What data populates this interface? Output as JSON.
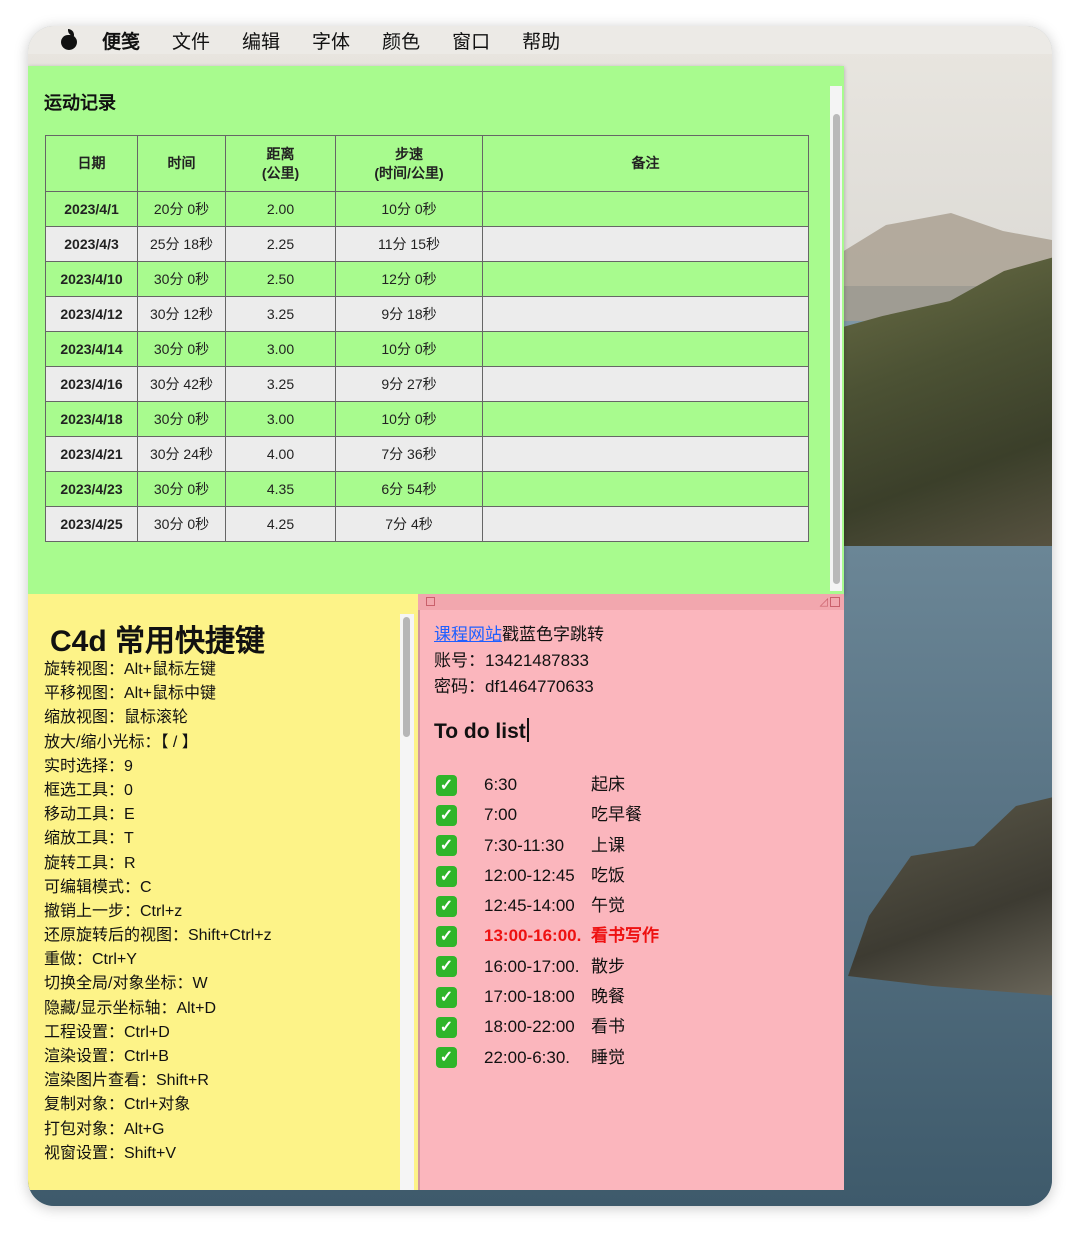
{
  "menubar": {
    "app_name": "便笺",
    "items": [
      "文件",
      "编辑",
      "字体",
      "颜色",
      "窗口",
      "帮助"
    ]
  },
  "exercise_note": {
    "title": "运动记录",
    "headers": [
      "日期",
      "时间",
      "距离\n(公里)",
      "步速\n(时间/公里)",
      "备注"
    ],
    "rows": [
      {
        "date": "2023/4/1",
        "time": "20分 0秒",
        "distance": "2.00",
        "pace": "10分 0秒",
        "note": ""
      },
      {
        "date": "2023/4/3",
        "time": "25分 18秒",
        "distance": "2.25",
        "pace": "11分 15秒",
        "note": ""
      },
      {
        "date": "2023/4/10",
        "time": "30分 0秒",
        "distance": "2.50",
        "pace": "12分 0秒",
        "note": ""
      },
      {
        "date": "2023/4/12",
        "time": "30分 12秒",
        "distance": "3.25",
        "pace": "9分 18秒",
        "note": ""
      },
      {
        "date": "2023/4/14",
        "time": "30分 0秒",
        "distance": "3.00",
        "pace": "10分 0秒",
        "note": ""
      },
      {
        "date": "2023/4/16",
        "time": "30分 42秒",
        "distance": "3.25",
        "pace": "9分 27秒",
        "note": ""
      },
      {
        "date": "2023/4/18",
        "time": "30分 0秒",
        "distance": "3.00",
        "pace": "10分 0秒",
        "note": ""
      },
      {
        "date": "2023/4/21",
        "time": "30分 24秒",
        "distance": "4.00",
        "pace": "7分 36秒",
        "note": ""
      },
      {
        "date": "2023/4/23",
        "time": "30分 0秒",
        "distance": "4.35",
        "pace": "6分 54秒",
        "note": ""
      },
      {
        "date": "2023/4/25",
        "time": "30分 0秒",
        "distance": "4.25",
        "pace": "7分 4秒",
        "note": ""
      }
    ]
  },
  "c4d_note": {
    "title": "C4d 常用快捷键",
    "shortcuts": [
      "旋转视图：Alt+鼠标左键",
      "平移视图：Alt+鼠标中键",
      "缩放视图：鼠标滚轮",
      "放大/缩小光标：【 / 】",
      "实时选择：9",
      "框选工具：0",
      "移动工具：E",
      "缩放工具：T",
      "旋转工具：R",
      "可编辑模式：C",
      "撤销上一步：Ctrl+z",
      "还原旋转后的视图：Shift+Ctrl+z",
      "重做：Ctrl+Y",
      "切换全局/对象坐标：W",
      "隐藏/显示坐标轴：Alt+D",
      "工程设置：Ctrl+D",
      "渲染设置：Ctrl+B",
      "渲染图片查看：Shift+R",
      "复制对象：Ctrl+对象",
      "打包对象：Alt+G",
      "视窗设置：Shift+V"
    ]
  },
  "todo_note": {
    "link_text": "课程网站",
    "link_suffix": "戳蓝色字跳转",
    "account": "账号：13421487833",
    "password": "密码：df1464770633",
    "title": "To do list",
    "items": [
      {
        "time": "6:30",
        "task": "起床",
        "highlight": false
      },
      {
        "time": "7:00",
        "task": "吃早餐",
        "highlight": false
      },
      {
        "time": "7:30-11:30",
        "task": "上课",
        "highlight": false
      },
      {
        "time": "12:00-12:45",
        "task": "吃饭",
        "highlight": false
      },
      {
        "time": "12:45-14:00",
        "task": "午觉",
        "highlight": false
      },
      {
        "time": "13:00-16:00.",
        "task": "看书写作",
        "highlight": true
      },
      {
        "time": "16:00-17:00.",
        "task": "散步",
        "highlight": false
      },
      {
        "time": "17:00-18:00",
        "task": "晚餐",
        "highlight": false
      },
      {
        "time": "18:00-22:00",
        "task": "看书",
        "highlight": false
      },
      {
        "time": "22:00-6:30.",
        "task": "睡觉",
        "highlight": false
      }
    ],
    "highlight_color": "#ee1111",
    "check_icon": "green-checkmark-icon"
  }
}
